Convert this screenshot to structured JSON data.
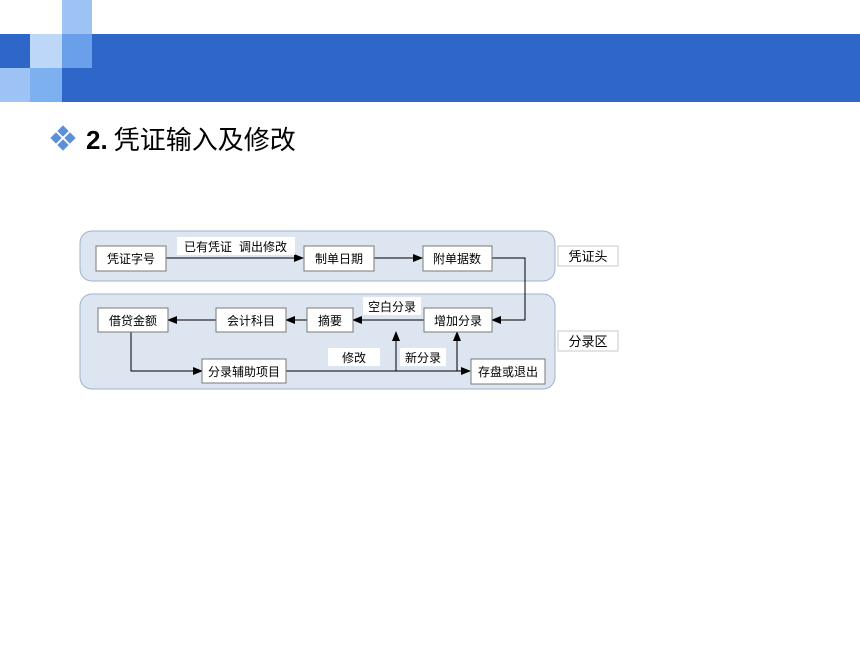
{
  "slide": {
    "title_number": "2.",
    "title_text": "凭证输入及修改"
  },
  "diagram": {
    "header_label": "凭证头",
    "entry_label": "分录区",
    "nodes": {
      "voucher_type": "凭证字号",
      "made_date": "制单日期",
      "attach_count": "附单据数",
      "debit_credit_amount": "借贷金额",
      "account_subject": "会计科目",
      "summary": "摘要",
      "add_entry": "增加分录",
      "aux_items": "分录辅助项目",
      "save_or_exit": "存盘或退出"
    },
    "edge_labels": {
      "existing_voucher": "已有凭证",
      "load_modify": "调出修改",
      "blank_entry": "空白分录",
      "modify": "修改",
      "new_entry": "新分录"
    }
  },
  "colors": {
    "header_band": "#2f67c9",
    "group_fill": "#dce5f0",
    "group_border": "#9fb3cc",
    "node_border": "#7a7a7a"
  }
}
